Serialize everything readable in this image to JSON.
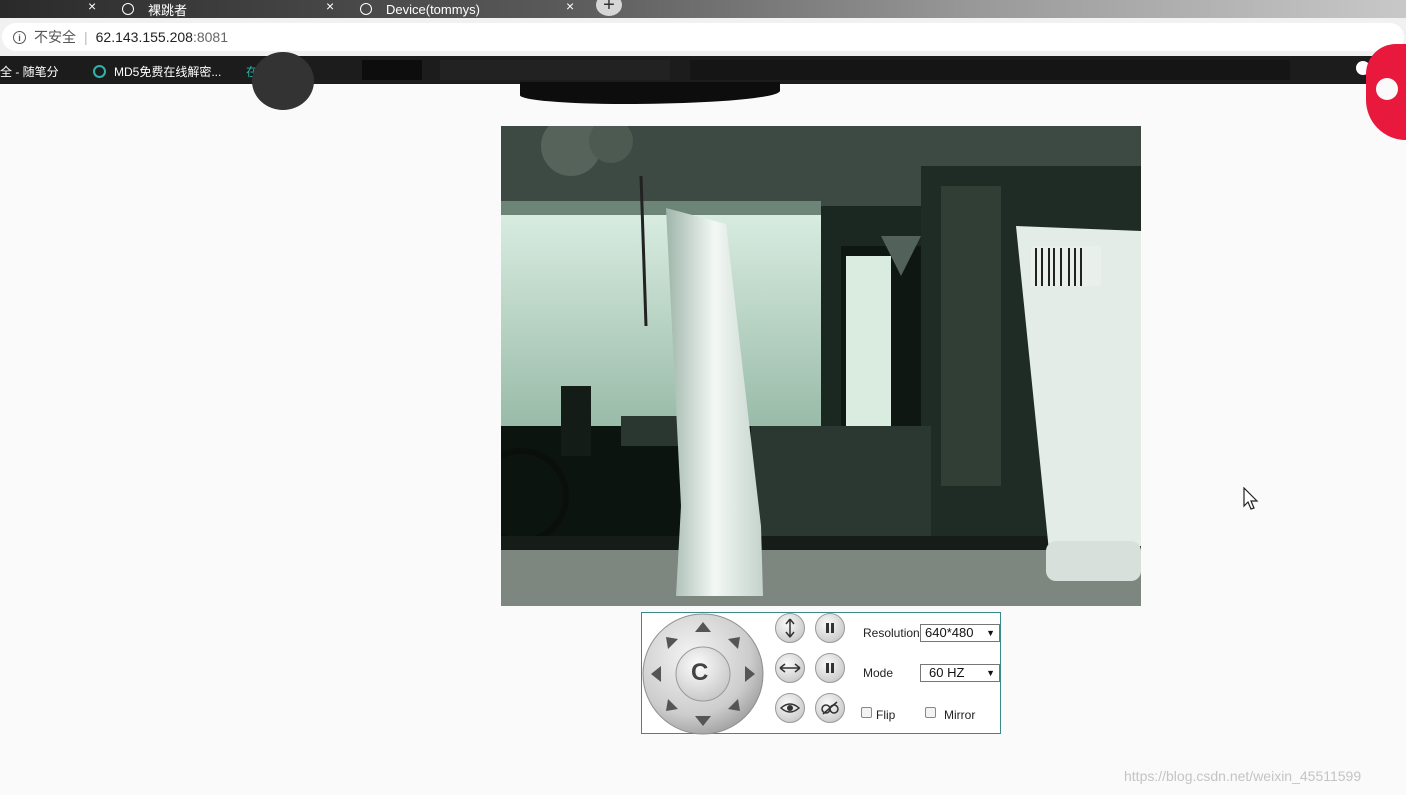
{
  "browser": {
    "tabs": [
      {
        "label": "",
        "active": false
      },
      {
        "label": "裸跳者",
        "active": false
      },
      {
        "label": "Device(tommys)",
        "active": false
      }
    ],
    "new_tab": "+",
    "close_glyph": "×",
    "address": {
      "insecure_label": "不安全",
      "separator": "|",
      "host": "62.143.155.208",
      "port": ":8081"
    },
    "bookmarks": [
      {
        "label": "全 - 随笔分"
      },
      {
        "label": "MD5免费在线解密..."
      },
      {
        "label": "在"
      }
    ]
  },
  "camera": {
    "controls": {
      "center_label": "C",
      "resolution_label": "Resolution",
      "resolution_value": "640*480",
      "mode_label": "Mode",
      "mode_value": "60 HZ",
      "flip_label": "Flip",
      "flip_checked": false,
      "mirror_label": "Mirror",
      "mirror_checked": false,
      "select_arrow": "▼"
    }
  },
  "watermark": "https://blog.csdn.net/weixin_45511599",
  "colors": {
    "panel_border": "#3a8a8a",
    "redact": "#0d0d0d",
    "page_bg": "#fafafa"
  }
}
